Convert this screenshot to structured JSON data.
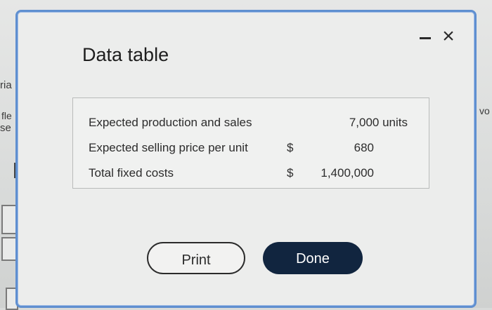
{
  "background": {
    "fragments": [
      "ria",
      "fle",
      "se",
      "vo"
    ]
  },
  "dialog": {
    "title": "Data table",
    "rows": [
      {
        "label": "Expected production and sales",
        "currency": "",
        "value": "7,000 units"
      },
      {
        "label": "Expected selling price per unit",
        "currency": "$",
        "value": "680"
      },
      {
        "label": "Total fixed costs",
        "currency": "$",
        "value": "1,400,000"
      }
    ],
    "buttons": {
      "print": "Print",
      "done": "Done"
    },
    "window_controls": {
      "minimize": "minimize-icon",
      "close": "close-icon"
    }
  },
  "colors": {
    "dialog_border": "#5f8fd0",
    "done_button": "#11253f"
  }
}
